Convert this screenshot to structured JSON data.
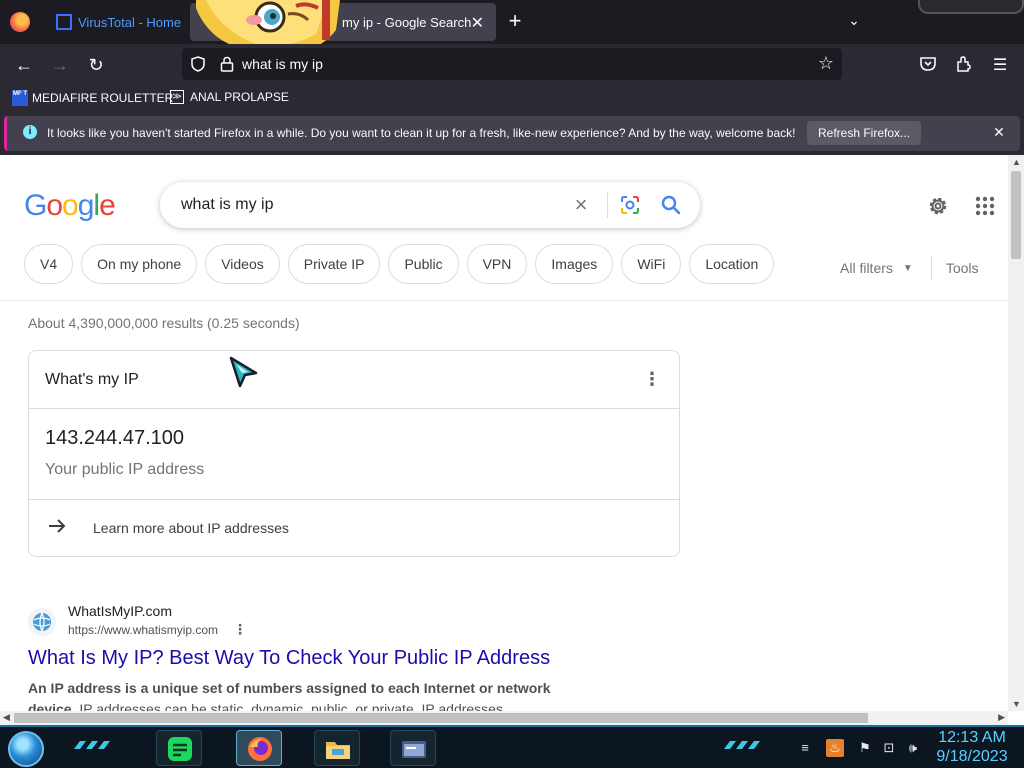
{
  "browser": {
    "tabs": [
      {
        "label": "VirusTotal - Home"
      },
      {
        "label": "my ip - Google Search"
      }
    ],
    "url": "what is my ip",
    "bookmarks": [
      {
        "label": "MEDIAFIRE ROULETTER",
        "icon_text": "MF T"
      },
      {
        "label": "ANAL PROLAPSE"
      }
    ],
    "notification": {
      "text": "It looks like you haven't started Firefox in a while. Do you want to clean it up for a fresh, like-new experience? And by the way, welcome back!",
      "button": "Refresh Firefox..."
    }
  },
  "google": {
    "logo_letters": [
      "G",
      "o",
      "o",
      "g",
      "l",
      "e"
    ],
    "query": "what is my ip",
    "chips": [
      "V4",
      "On my phone",
      "Videos",
      "Private IP",
      "Public",
      "VPN",
      "Images",
      "WiFi",
      "Location"
    ],
    "all_filters": "All filters",
    "tools": "Tools",
    "stats": "About 4,390,000,000 results (0.25 seconds)",
    "ip_card": {
      "title": "What's my IP",
      "ip": "143.244.47.100",
      "subtitle": "Your public IP address",
      "learn_more": "Learn more about IP addresses"
    },
    "result": {
      "site": "WhatIsMyIP.com",
      "url": "https://www.whatismyip.com",
      "title": "What Is My IP? Best Way To Check Your Public IP Address",
      "snippet_bold": "An IP address is a unique set of numbers assigned to each Internet or network device.",
      "snippet": " IP addresses can be static, dynamic, public, or private. IP addresses ..."
    }
  },
  "taskbar": {
    "time": "12:13 AM",
    "date": "9/18/2023"
  },
  "colors": {
    "firefox_dark": "#1c1b22",
    "firefox_toolbar": "#2b2a33",
    "google_link": "#1a0dab",
    "clock": "#59d2ff"
  }
}
